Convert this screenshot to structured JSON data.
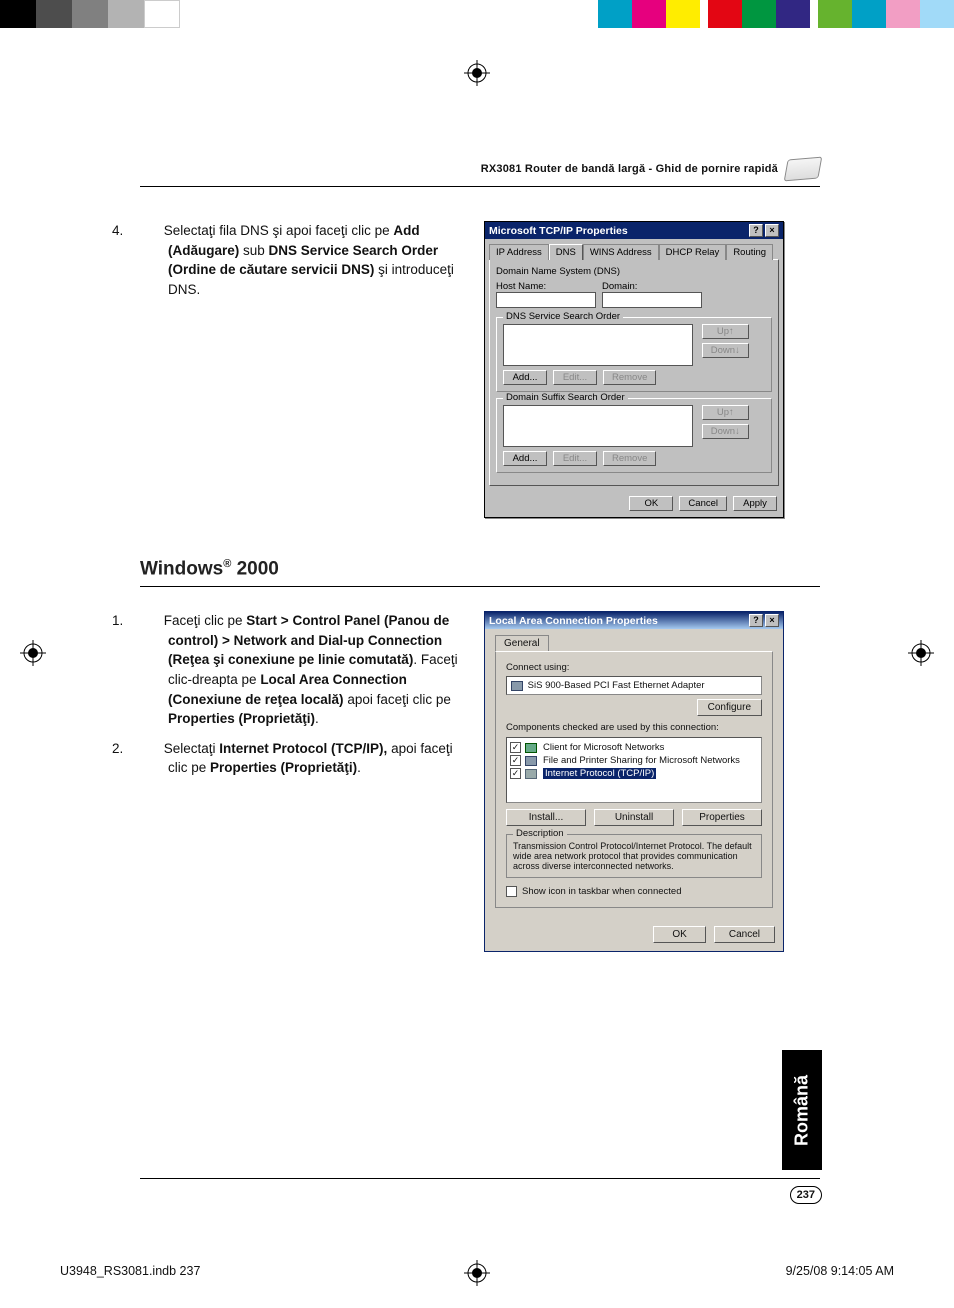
{
  "colorbar": [
    "#000000",
    "#4d4d4d",
    "#808080",
    "#b3b3b3",
    "#ffffff",
    "#00a0c6",
    "#e6007e",
    "#ffed00",
    "#e30613",
    "#009640",
    "#312783",
    "#66b32e",
    "#00a0c6",
    "#f29ec4",
    "#a1daf8"
  ],
  "header": {
    "runhead": "RX3081 Router de bandă largă - Ghid de pornire rapidă"
  },
  "step4": {
    "num": "4.",
    "text_a": "Selectaţi fila DNS şi apoi faceţi clic pe ",
    "bold_a": "Add (Adăugare)",
    "text_b": " sub ",
    "bold_b": "DNS Service Search Order (Ordine de căutare servicii DNS)",
    "text_c": " şi introduceţi DNS."
  },
  "dlg1": {
    "title": "Microsoft TCP/IP Properties",
    "tabs": [
      "IP Address",
      "DNS",
      "WINS Address",
      "DHCP Relay",
      "Routing"
    ],
    "grp_dns": "Domain Name System (DNS)",
    "lbl_host": "Host Name:",
    "lbl_domain": "Domain:",
    "grp_search": "DNS Service Search Order",
    "grp_suffix": "Domain Suffix Search Order",
    "btn_up": "Up↑",
    "btn_down": "Down↓",
    "btn_add": "Add...",
    "btn_edit": "Edit...",
    "btn_remove": "Remove",
    "btn_ok": "OK",
    "btn_cancel": "Cancel",
    "btn_apply": "Apply"
  },
  "h2": {
    "pre": "Windows",
    "sup": "®",
    "post": " 2000"
  },
  "step1": {
    "num": "1.",
    "t1": "Faceţi clic pe ",
    "b1": "Start > Control Panel (Panou de control) > Network and Dial-up Connection (Reţea şi conexiune pe linie comutată)",
    "t2": ". Faceţi clic-dreapta pe ",
    "b2": "Local Area Connection (Conexiune de reţea locală)",
    "t3": " apoi faceţi clic pe ",
    "b3": "Properties (Proprietăţi)",
    "t4": "."
  },
  "step2": {
    "num": "2.",
    "t1": "Selectaţi ",
    "b1": "Internet Protocol (TCP/IP),",
    "t2": " apoi faceţi clic pe ",
    "b2": "Properties (Proprietăţi)",
    "t3": "."
  },
  "dlg2": {
    "title": "Local Area Connection Properties",
    "tab": "General",
    "lbl_connect": "Connect using:",
    "adapter": "SiS 900-Based PCI Fast Ethernet Adapter",
    "btn_configure": "Configure",
    "lbl_components": "Components checked are used by this connection:",
    "items": [
      {
        "checked": true,
        "label": "Client for Microsoft Networks"
      },
      {
        "checked": true,
        "label": "File and Printer Sharing for Microsoft Networks"
      },
      {
        "checked": true,
        "label": "Internet Protocol (TCP/IP)",
        "selected": true
      }
    ],
    "btn_install": "Install...",
    "btn_uninstall": "Uninstall",
    "btn_props": "Properties",
    "desc_title": "Description",
    "desc": "Transmission Control Protocol/Internet Protocol. The default wide area network protocol that provides communication across diverse interconnected networks.",
    "chk_taskbar": "Show icon in taskbar when connected",
    "btn_ok": "OK",
    "btn_cancel": "Cancel"
  },
  "sidetab": "Română",
  "pagenum": "237",
  "footer": {
    "left": "U3948_RS3081.indb   237",
    "right": "9/25/08   9:14:05 AM"
  }
}
